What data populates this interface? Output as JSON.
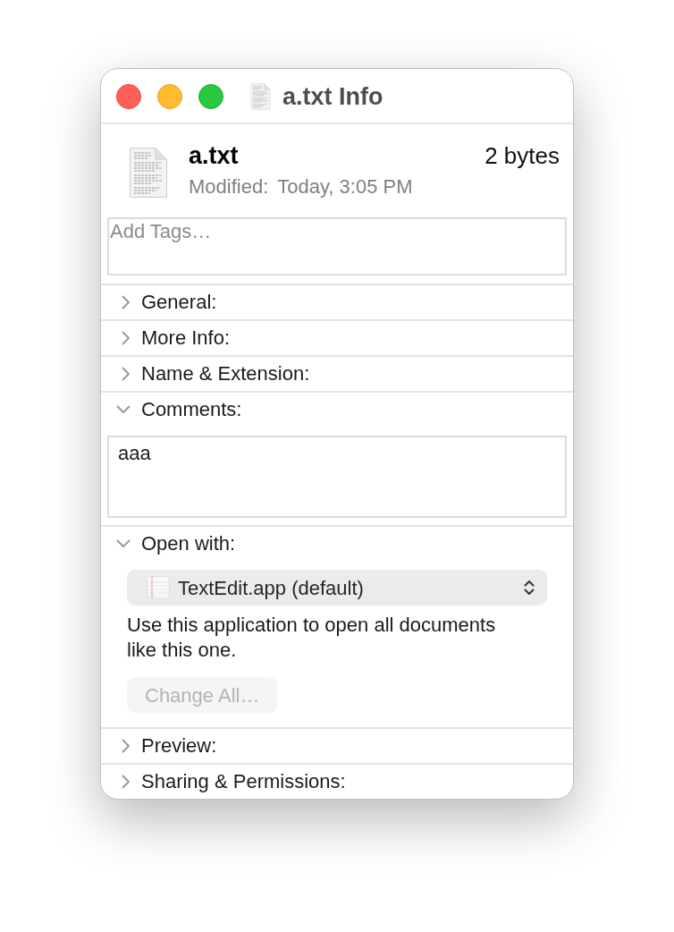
{
  "window": {
    "title": "a.txt Info"
  },
  "file": {
    "name": "a.txt",
    "size": "2 bytes",
    "modified_label": "Modified:",
    "modified": "Today, 3:05 PM"
  },
  "tags": {
    "placeholder": "Add Tags…"
  },
  "sections": [
    {
      "label": "General:",
      "expanded": false
    },
    {
      "label": "More Info:",
      "expanded": false
    },
    {
      "label": "Name & Extension:",
      "expanded": false
    },
    {
      "kind": "comments",
      "label": "Comments:",
      "expanded": true,
      "comment": "aaa"
    },
    {
      "kind": "open_with",
      "label": "Open with:",
      "expanded": true,
      "app": "TextEdit.app (default)",
      "description": "Use this application to open all documents like this one.",
      "button": {
        "label": "Change All…",
        "disabled": true
      }
    },
    {
      "label": "Preview:",
      "expanded": false
    },
    {
      "label": "Sharing & Permissions:",
      "expanded": false
    }
  ]
}
